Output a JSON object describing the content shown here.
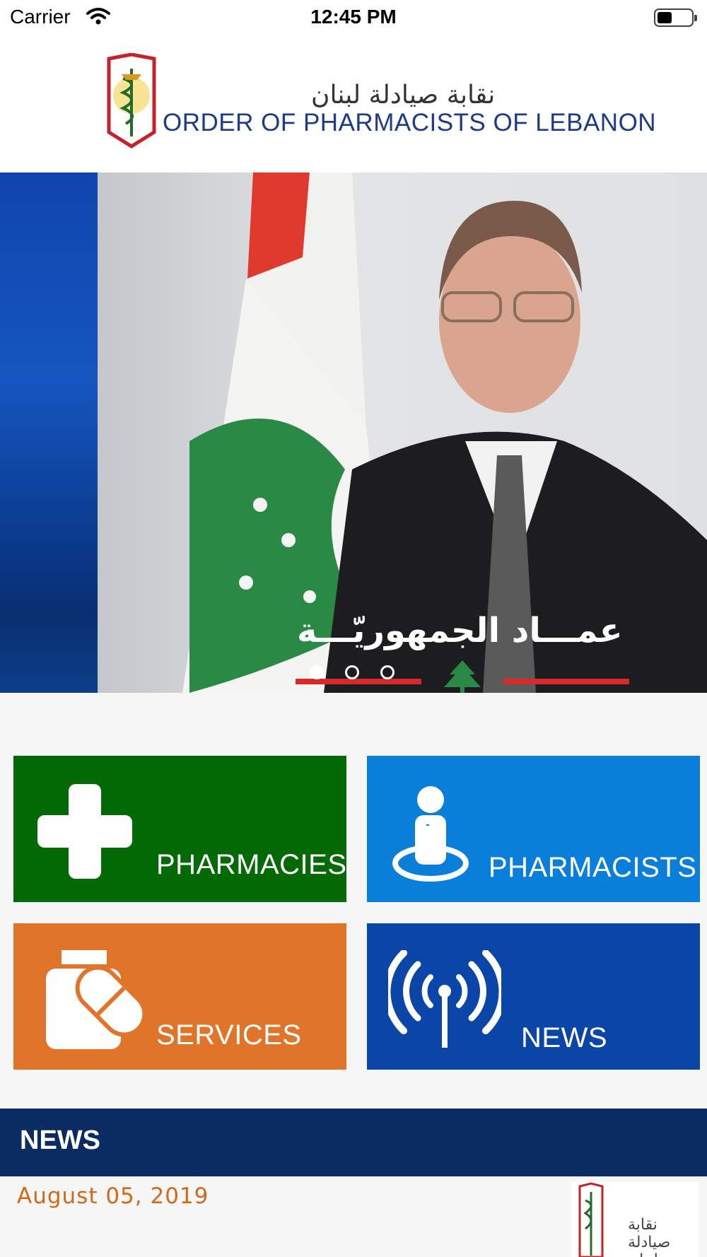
{
  "status_bar": {
    "carrier": "Carrier",
    "time": "12:45 PM"
  },
  "header": {
    "logo_arabic": "نقابة صيادلة لبنان",
    "logo_english": "ORDER OF PHARMACISTS OF LEBANON"
  },
  "slider": {
    "caption": "عمـــاد الجمهوريّـــة",
    "dots_count": 3,
    "active_dot": 0
  },
  "tiles": [
    {
      "label": "PHARMACIES",
      "icon": "plus-icon",
      "color": "#036a05"
    },
    {
      "label": "PHARMACISTS",
      "icon": "person-icon",
      "color": "#0a7fd9"
    },
    {
      "label": "SERVICES",
      "icon": "medicine-icon",
      "color": "#e07429"
    },
    {
      "label": "NEWS",
      "icon": "broadcast-icon",
      "color": "#0a45a8"
    }
  ],
  "news": {
    "title": "NEWS",
    "items": [
      {
        "date": "August 05, 2019",
        "thumb_text": "نقابة صيادلة لبنان"
      }
    ]
  }
}
